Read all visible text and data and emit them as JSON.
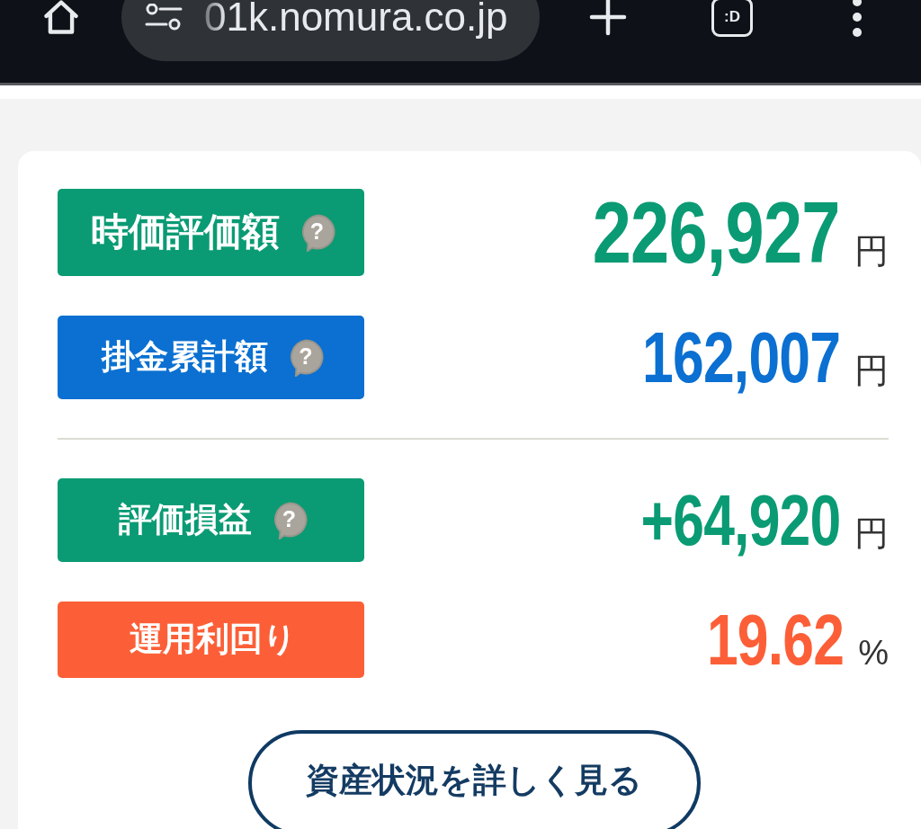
{
  "browser_bar": {
    "url": "01k.nomura.co.jp",
    "tab_switcher": ":D"
  },
  "summary": {
    "groups": [
      {
        "metrics": [
          {
            "kind": "main",
            "label": "時価評価額",
            "help": "?",
            "value": "226,927",
            "unit": "円",
            "color": "#0a9b74"
          },
          {
            "kind": "sub",
            "label": "掛金累計額",
            "help": "?",
            "value": "162,007",
            "unit": "円",
            "color": "#0b70d1"
          }
        ]
      },
      {
        "metrics": [
          {
            "kind": "sub",
            "label": "評価損益",
            "help": "?",
            "value": "+64,920",
            "unit": "円",
            "color": "#0a9b74"
          },
          {
            "kind": "sub",
            "label": "運用利回り",
            "value": "19.62",
            "unit": "%",
            "color": "#fc5f37"
          }
        ]
      }
    ],
    "details_button": "資産状況を詳しく見る"
  }
}
